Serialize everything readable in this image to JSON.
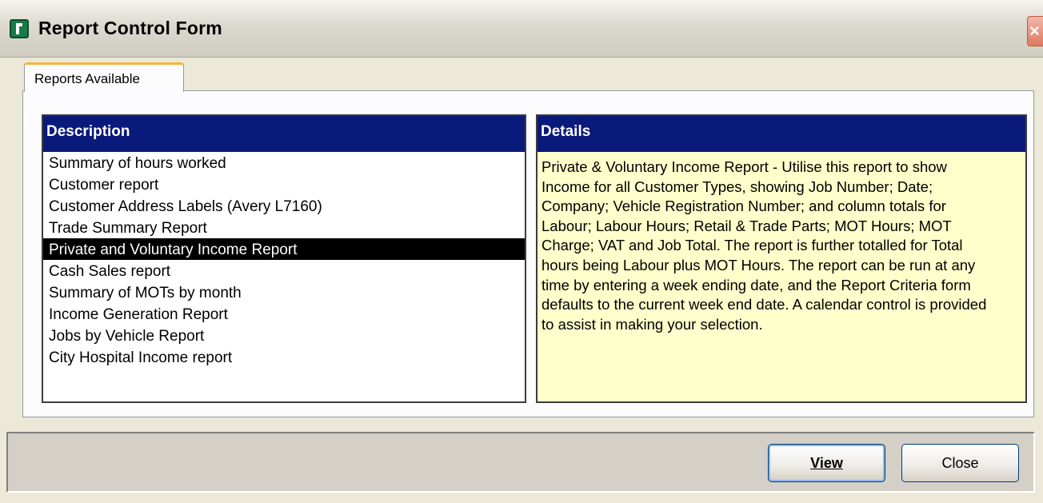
{
  "window": {
    "title": "Report Control Form",
    "close_glyph": "×"
  },
  "tabs": [
    {
      "label": "Reports Available",
      "active": true
    }
  ],
  "description_panel": {
    "header": "Description",
    "items": [
      "Summary of hours worked",
      "Customer report",
      "Customer Address Labels (Avery L7160)",
      "Trade Summary Report",
      "Private and Voluntary Income Report",
      "Cash Sales report",
      "Summary of MOTs by month",
      "Income Generation Report",
      "Jobs by Vehicle Report",
      "City Hospital Income report"
    ],
    "selected_item": "Private and Voluntary Income Report"
  },
  "details_panel": {
    "header": "Details",
    "text": "Private & Voluntary Income Report - Utilise this report to show Income for all Customer Types, showing Job Number; Date; Company; Vehicle Registration Number; and column totals for Labour; Labour Hours; Retail & Trade Parts; MOT Hours; MOT Charge; VAT and Job Total. The report is further totalled for Total hours being Labour plus MOT Hours. The report can be run at any time by entering a week ending date, and the Report Criteria form defaults to the current week end date. A calendar control is provided to assist in making your selection."
  },
  "buttons": {
    "view_label": "View",
    "close_label": "Close"
  },
  "colors": {
    "header_bg": "#0a1a7a",
    "details_bg": "#ffffcc",
    "selection_bg": "#000000",
    "tab_accent": "#f4b43c"
  },
  "icons": {
    "app": "app-icon",
    "close": "close-icon"
  }
}
